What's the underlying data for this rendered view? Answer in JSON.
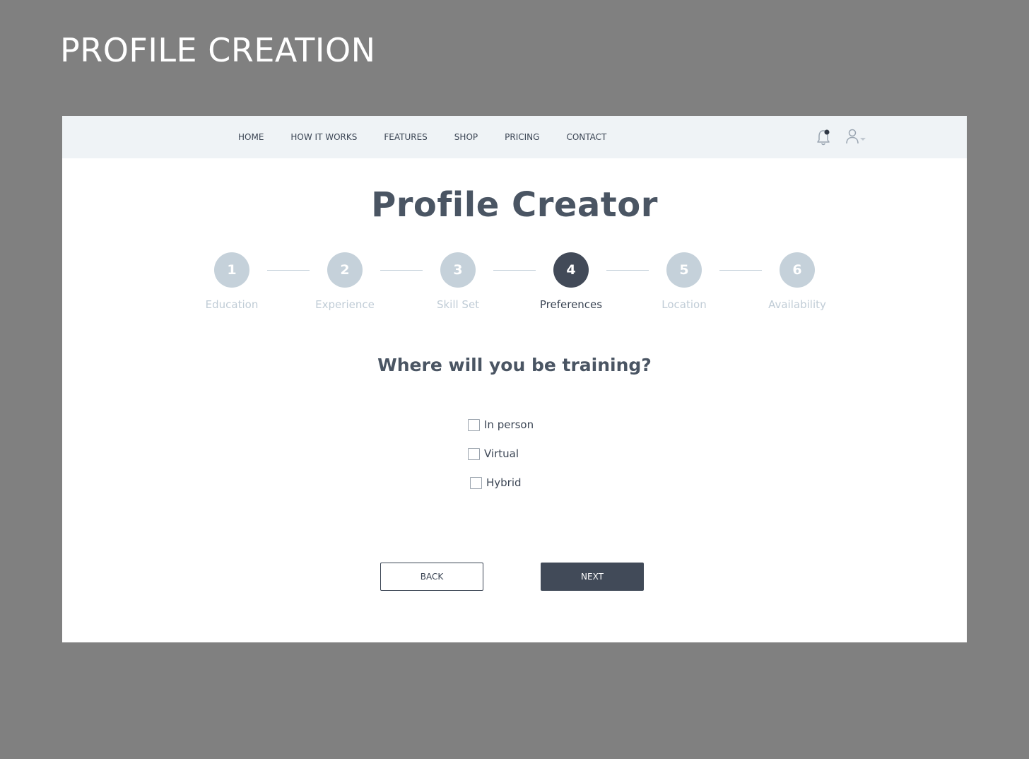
{
  "page": {
    "heading": "PROFILE CREATION"
  },
  "nav": {
    "links": [
      "HOME",
      "HOW IT WORKS",
      "FEATURES",
      "SHOP",
      "PRICING",
      "CONTACT"
    ],
    "notification_indicator": true
  },
  "main": {
    "title": "Profile Creator",
    "steps": [
      {
        "number": "1",
        "label": "Education"
      },
      {
        "number": "2",
        "label": "Experience"
      },
      {
        "number": "3",
        "label": "Skill Set"
      },
      {
        "number": "4",
        "label": "Preferences"
      },
      {
        "number": "5",
        "label": "Location"
      },
      {
        "number": "6",
        "label": "Availability"
      }
    ],
    "active_step": 4,
    "question": "Where will you be training?",
    "options": [
      {
        "label": "In person",
        "checked": false
      },
      {
        "label": "Virtual",
        "checked": false
      },
      {
        "label": "Hybrid",
        "checked": false
      }
    ],
    "back_label": "BACK",
    "next_label": "NEXT"
  },
  "colors": {
    "backdrop": "#808080",
    "navbar": "#eff3f6",
    "accent": "#424a58",
    "inactive_step": "#c5d1da"
  }
}
